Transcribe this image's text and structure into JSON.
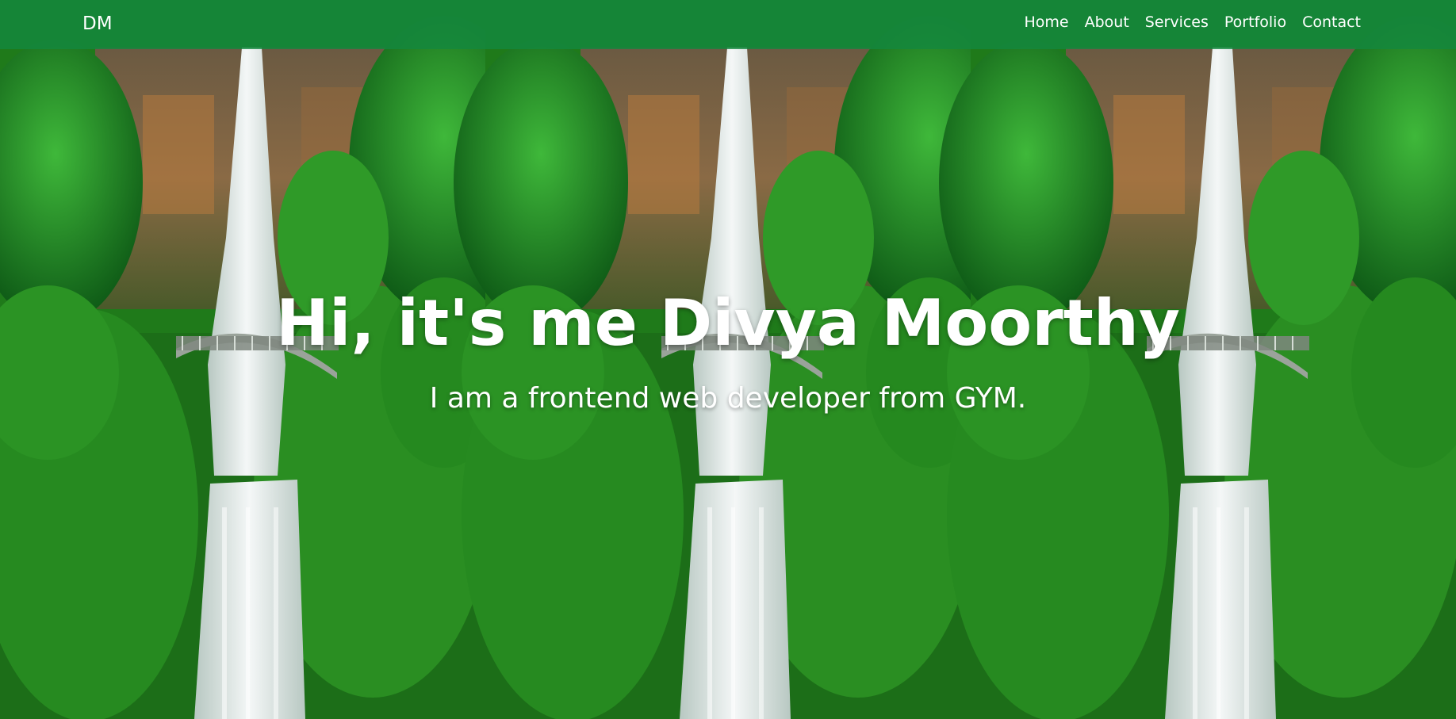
{
  "brand": {
    "label": "DM"
  },
  "nav": {
    "items": [
      {
        "label": "Home"
      },
      {
        "label": "About"
      },
      {
        "label": "Services"
      },
      {
        "label": "Portfolio"
      },
      {
        "label": "Contact"
      }
    ]
  },
  "hero": {
    "title": "Hi, it's me Divya Moorthy",
    "subtitle": "I am a frontend web developer from GYM."
  },
  "colors": {
    "nav_bg": "#13883e",
    "text": "#ffffff",
    "foliage": "#2e9b1f",
    "rock": "#7a5b3a",
    "water": "#e8eef0"
  },
  "background": {
    "image": "waterfall-forest-tiled",
    "tiles": 3
  }
}
